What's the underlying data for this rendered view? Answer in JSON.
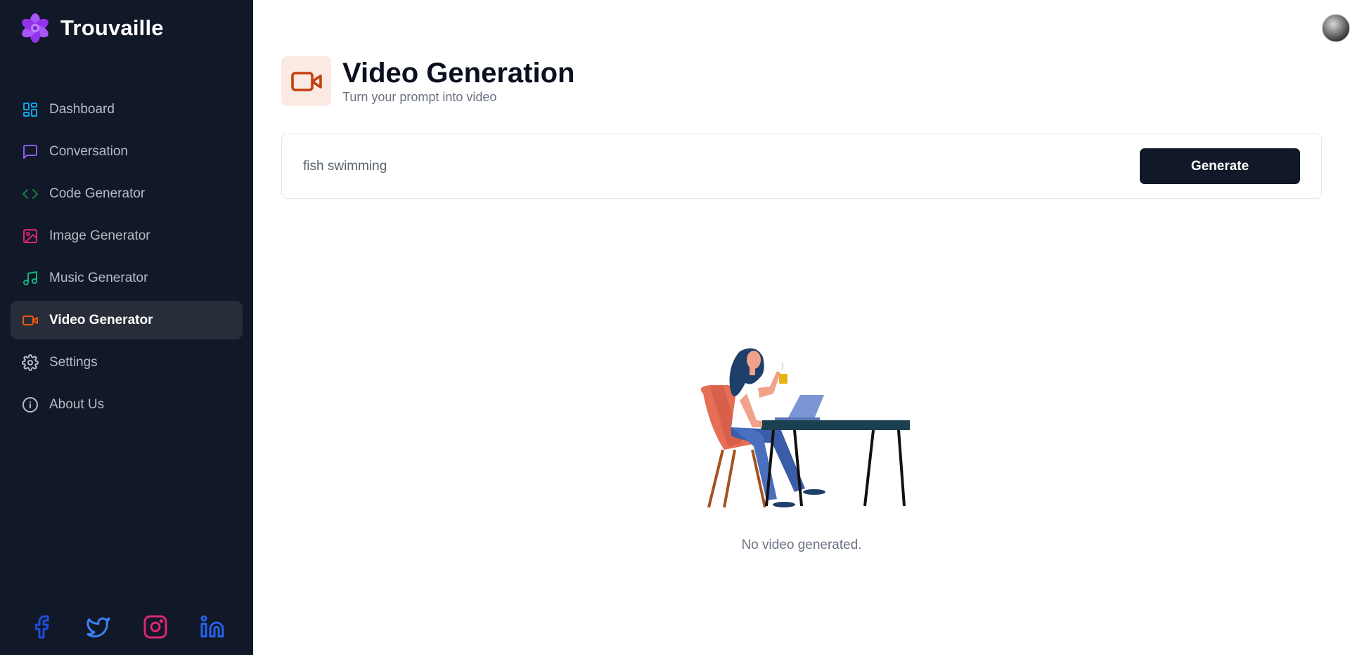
{
  "app": {
    "name": "Trouvaille"
  },
  "sidebar": {
    "items": [
      {
        "label": "Dashboard",
        "icon": "dashboard-icon",
        "color": "#0ea5e9",
        "active": false
      },
      {
        "label": "Conversation",
        "icon": "chat-icon",
        "color": "#8b5cf6",
        "active": false
      },
      {
        "label": "Code Generator",
        "icon": "code-icon",
        "color": "#15803d",
        "active": false
      },
      {
        "label": "Image Generator",
        "icon": "image-icon",
        "color": "#db2777",
        "active": false
      },
      {
        "label": "Music Generator",
        "icon": "music-icon",
        "color": "#10b981",
        "active": false
      },
      {
        "label": "Video Generator",
        "icon": "video-icon",
        "color": "#ea580c",
        "active": true
      },
      {
        "label": "Settings",
        "icon": "gear-icon",
        "color": "#b7bcc6",
        "active": false
      },
      {
        "label": "About Us",
        "icon": "info-icon",
        "color": "#b7bcc6",
        "active": false
      }
    ],
    "socials": [
      {
        "name": "facebook-icon",
        "color": "#1d4ed8"
      },
      {
        "name": "twitter-icon",
        "color": "#3b82f6"
      },
      {
        "name": "instagram-icon",
        "color": "#db2777"
      },
      {
        "name": "linkedin-icon",
        "color": "#2563eb"
      }
    ]
  },
  "page": {
    "title": "Video Generation",
    "subtitle": "Turn your prompt into video",
    "accent_color": "#c2410c",
    "accent_bg": "#fbeae3"
  },
  "prompt": {
    "value": "fish swimming",
    "button_label": "Generate"
  },
  "empty_state": {
    "message": "No video generated."
  }
}
